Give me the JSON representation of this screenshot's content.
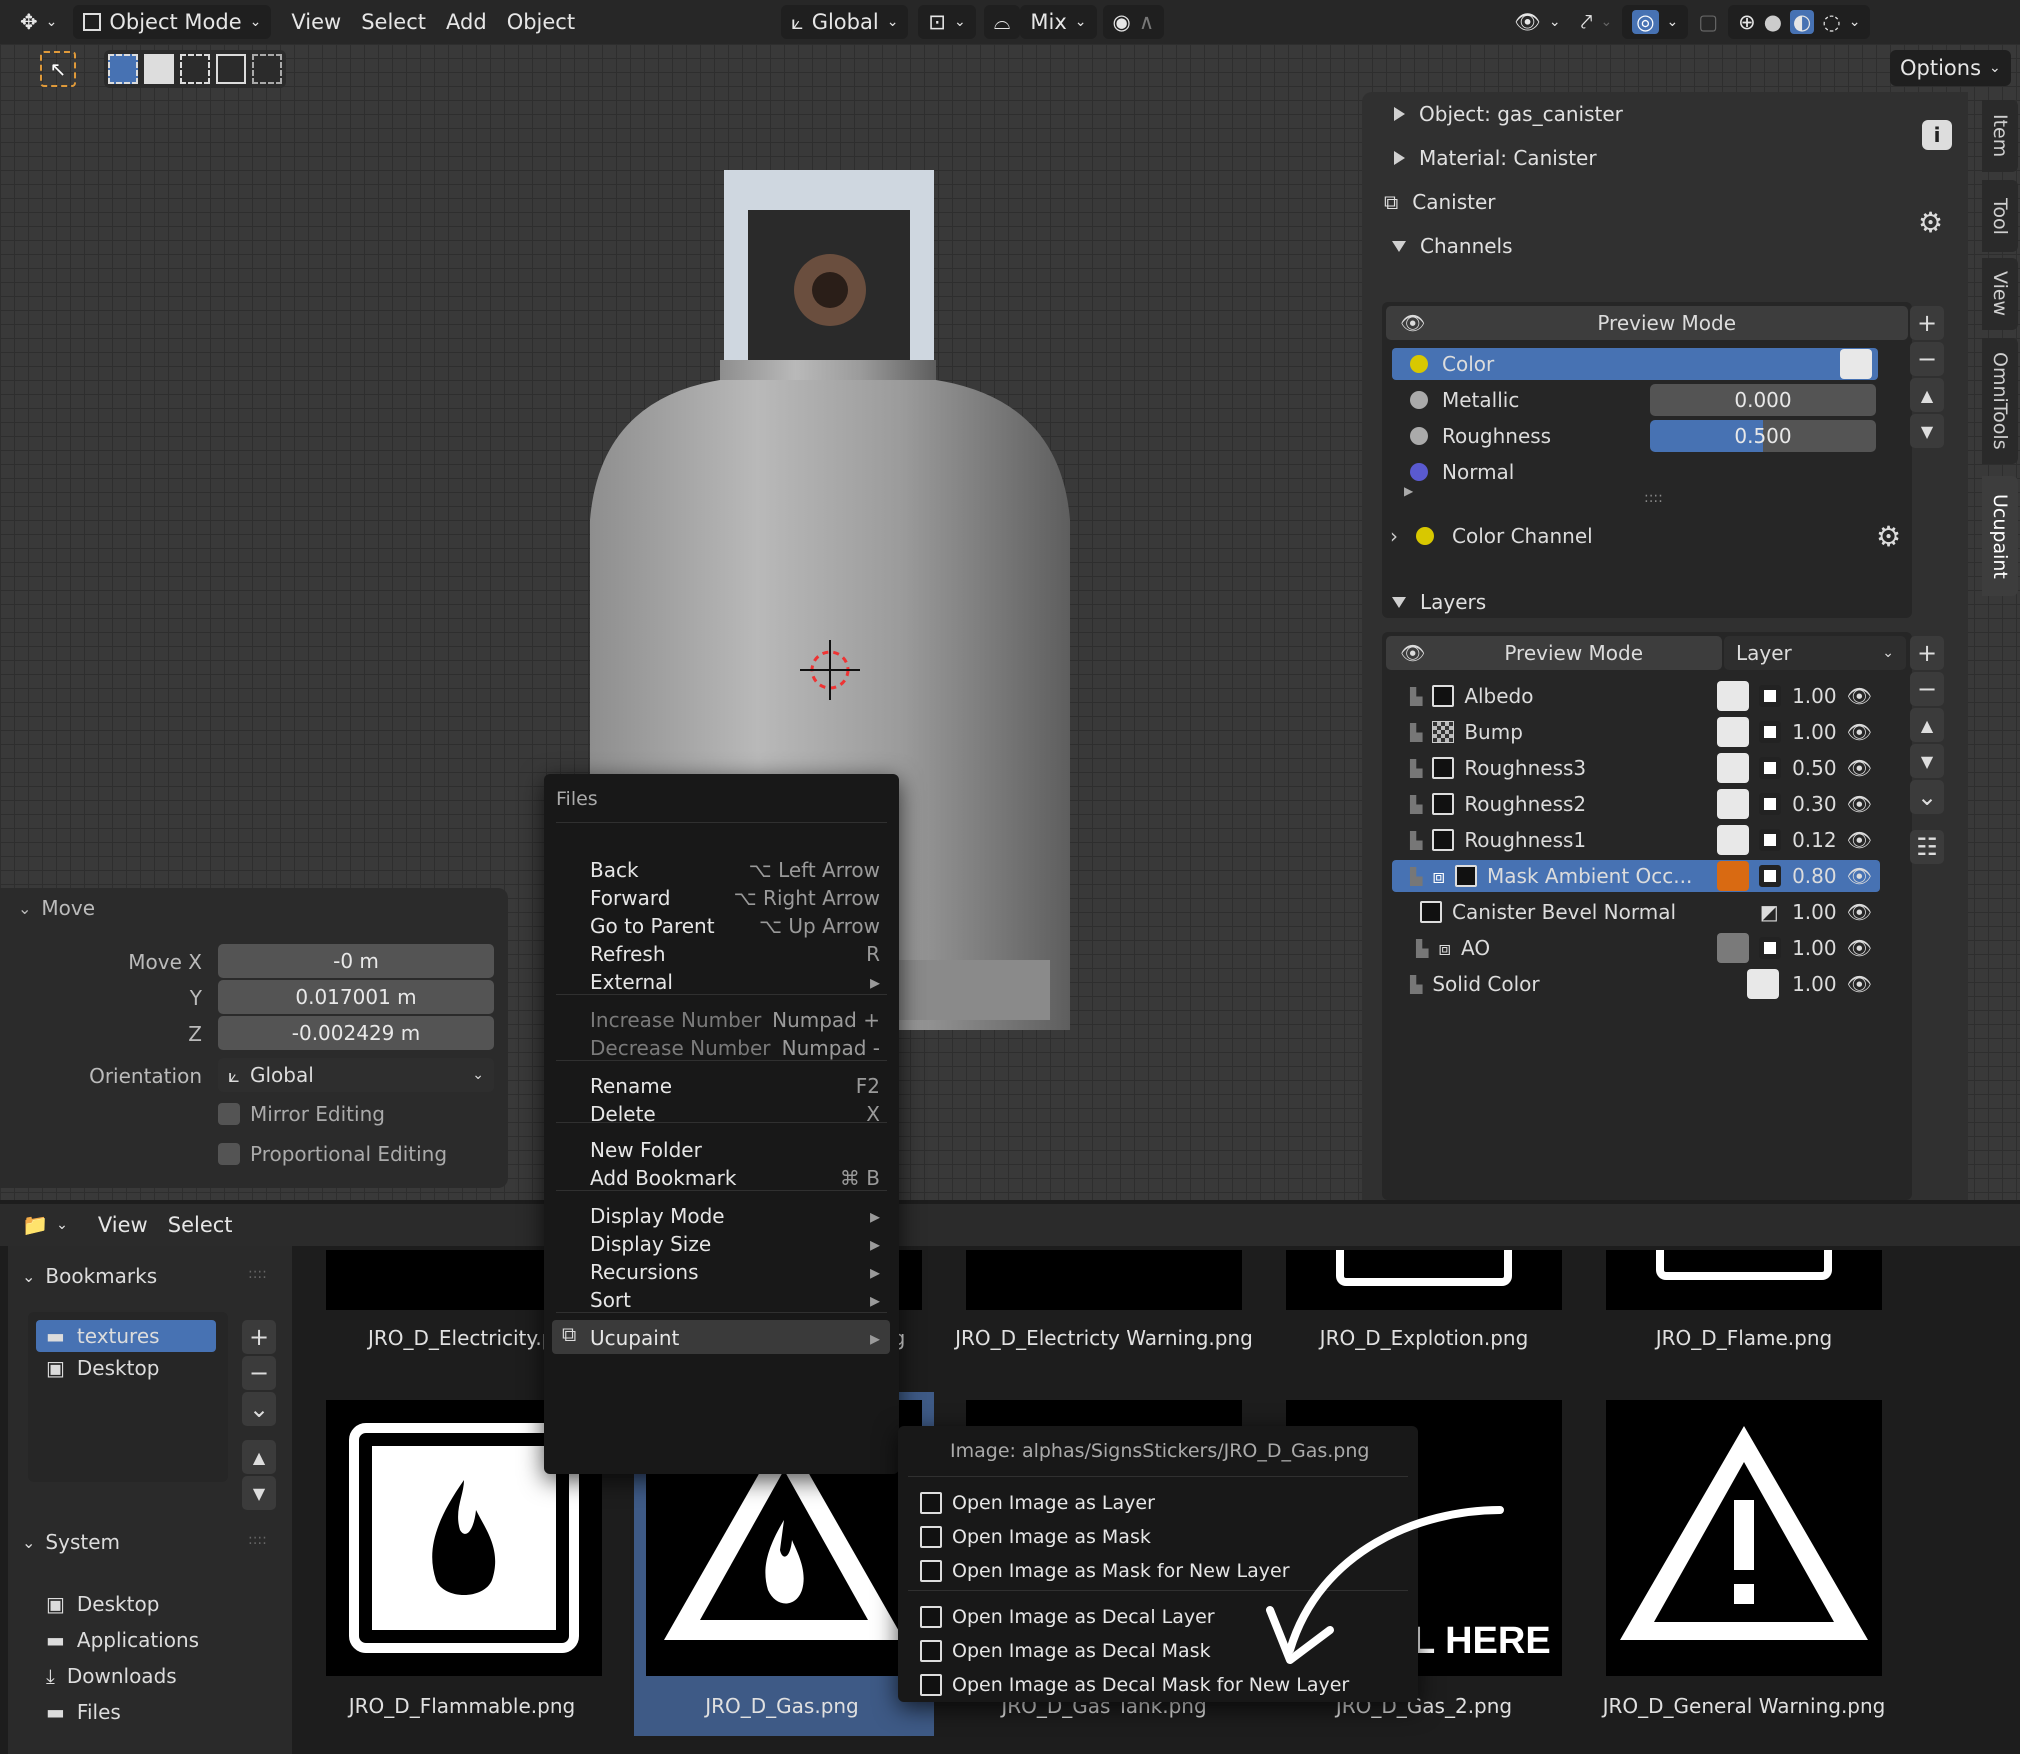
{
  "header": {
    "mode": "Object Mode",
    "menus": [
      "View",
      "Select",
      "Add",
      "Object"
    ],
    "orientation": "Global",
    "mix": "Mix",
    "options": "Options"
  },
  "npanel": {
    "object": "Object: gas_canister",
    "material": "Material: Canister",
    "canister": "Canister",
    "channels": "Channels",
    "preview_mode": "Preview Mode",
    "channel_list": [
      {
        "name": "Color",
        "color": "#d8c800"
      },
      {
        "name": "Metallic",
        "value": "0.000"
      },
      {
        "name": "Roughness",
        "value": "0.500"
      },
      {
        "name": "Normal",
        "color": "#5a5ad0"
      }
    ],
    "color_channel": "Color Channel",
    "layers": "Layers",
    "layer_dropdown": "Layer",
    "layer_list": [
      {
        "name": "Albedo",
        "value": "1.00"
      },
      {
        "name": "Bump",
        "value": "1.00"
      },
      {
        "name": "Roughness3",
        "value": "0.50"
      },
      {
        "name": "Roughness2",
        "value": "0.30"
      },
      {
        "name": "Roughness1",
        "value": "0.12"
      },
      {
        "name": "Mask Ambient Occ...",
        "value": "0.80"
      },
      {
        "name": "Canister Bevel Normal",
        "value": "1.00"
      },
      {
        "name": "AO",
        "value": "1.00"
      },
      {
        "name": "Solid Color",
        "value": "1.00"
      }
    ]
  },
  "tabs": [
    "Item",
    "Tool",
    "View",
    "OmniTools",
    "Ucupaint"
  ],
  "move": {
    "title": "Move",
    "move_x_label": "Move X",
    "x": "-0 m",
    "y_label": "Y",
    "y": "0.017001 m",
    "z_label": "Z",
    "z": "-0.002429 m",
    "orientation_label": "Orientation",
    "orientation": "Global",
    "mirror": "Mirror Editing",
    "proportional": "Proportional Editing"
  },
  "filebrowser": {
    "menus": [
      "View",
      "Select"
    ],
    "bookmarks": "Bookmarks",
    "bookmark_items": [
      "textures",
      "Desktop"
    ],
    "system": "System",
    "system_items": [
      "Desktop",
      "Applications",
      "Downloads",
      "Files"
    ],
    "files_row1": [
      "JRO_D_Electricity.pi",
      "ng",
      "JRO_D_Electricty Warning.png",
      "JRO_D_Explotion.png",
      "JRO_D_Flame.png"
    ],
    "files_row2": [
      "JRO_D_Flammable.png",
      "JRO_D_Gas.png",
      "JRO_D_Gas Tank.png",
      "JRO_D_Gas_2.png",
      "JRO_D_General Warning.png"
    ],
    "gas_text": "L HERE"
  },
  "ctx": {
    "title": "Files",
    "items": [
      {
        "label": "Back",
        "sc": "⌥ Left Arrow"
      },
      {
        "label": "Forward",
        "sc": "⌥ Right Arrow"
      },
      {
        "label": "Go to Parent",
        "sc": "⌥ Up Arrow"
      },
      {
        "label": "Refresh",
        "sc": "R"
      },
      {
        "label": "External",
        "sc": "▸"
      },
      {
        "label": "Increase Number",
        "sc": "Numpad +"
      },
      {
        "label": "Decrease Number",
        "sc": "Numpad -"
      },
      {
        "label": "Rename",
        "sc": "F2"
      },
      {
        "label": "Delete",
        "sc": "X"
      },
      {
        "label": "New Folder",
        "sc": ""
      },
      {
        "label": "Add Bookmark",
        "sc": "⌘ B"
      },
      {
        "label": "Display Mode",
        "sc": "▸"
      },
      {
        "label": "Display Size",
        "sc": "▸"
      },
      {
        "label": "Recursions",
        "sc": "▸"
      },
      {
        "label": "Sort",
        "sc": "▸"
      },
      {
        "label": "Ucupaint",
        "sc": "▸"
      }
    ]
  },
  "sub": {
    "title": "Image: alphas/SignsStickers/JRO_D_Gas.png",
    "items": [
      "Open Image as Layer",
      "Open Image as Mask",
      "Open Image as Mask for New Layer",
      "Open Image as Decal Layer",
      "Open Image as Decal Mask",
      "Open Image as Decal Mask for New Layer"
    ]
  },
  "colors": {
    "accent": "#4772b3",
    "orange": "#d96a12"
  }
}
